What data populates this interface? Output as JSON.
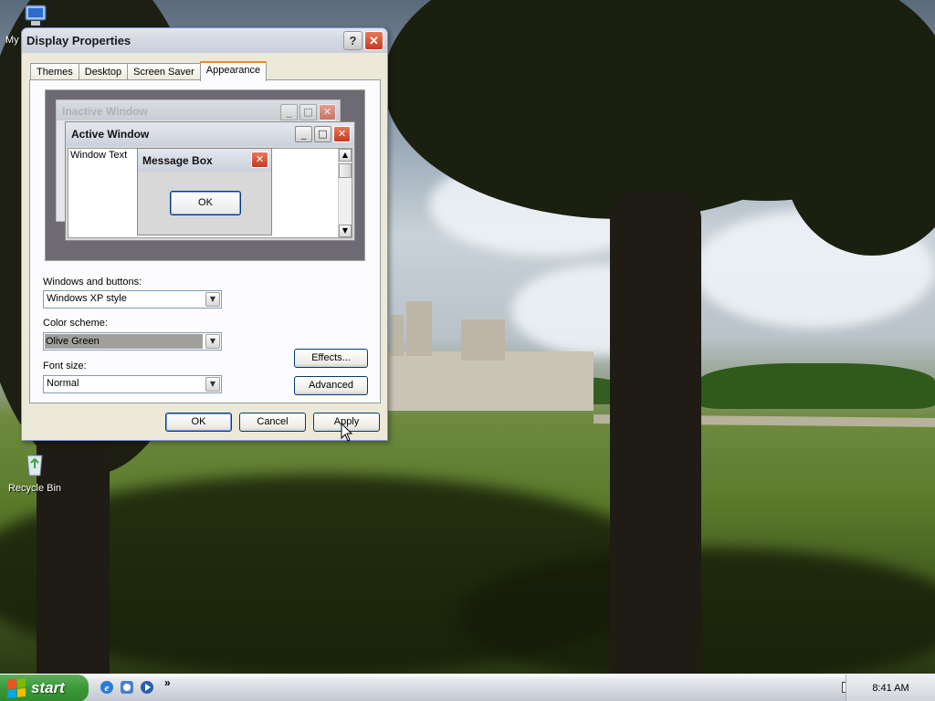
{
  "desktop": {
    "icons": [
      {
        "label": "My",
        "name": "my-computer-icon"
      },
      {
        "label": "Recycle Bin",
        "name": "recycle-bin-icon"
      }
    ]
  },
  "dialog": {
    "title": "Display Properties",
    "help_glyph": "?",
    "close_glyph": "✕",
    "tabs": [
      "Themes",
      "Desktop",
      "Screen Saver",
      "Appearance"
    ],
    "active_tab": "Appearance",
    "preview": {
      "inactive_title": "Inactive Window",
      "active_title": "Active Window",
      "window_text": "Window Text",
      "message_title": "Message Box",
      "message_ok": "OK"
    },
    "windows_buttons_label": "Windows and buttons:",
    "windows_buttons_value": "Windows XP style",
    "color_scheme_label": "Color scheme:",
    "color_scheme_value": "Olive Green",
    "font_size_label": "Font size:",
    "font_size_value": "Normal",
    "effects_label": "Effects...",
    "advanced_label": "Advanced",
    "ok_label": "OK",
    "cancel_label": "Cancel",
    "apply_label": "Apply"
  },
  "taskbar": {
    "start_label": "start",
    "quick_launch": [
      "internet-explorer-icon",
      "media-center-icon",
      "media-player-icon"
    ],
    "chevron": "»",
    "clock": "8:41 AM"
  },
  "colors": {
    "title_bar_blue": "#0831d9",
    "start_green": "#3c9a3a",
    "close_red": "#c43b1f"
  }
}
